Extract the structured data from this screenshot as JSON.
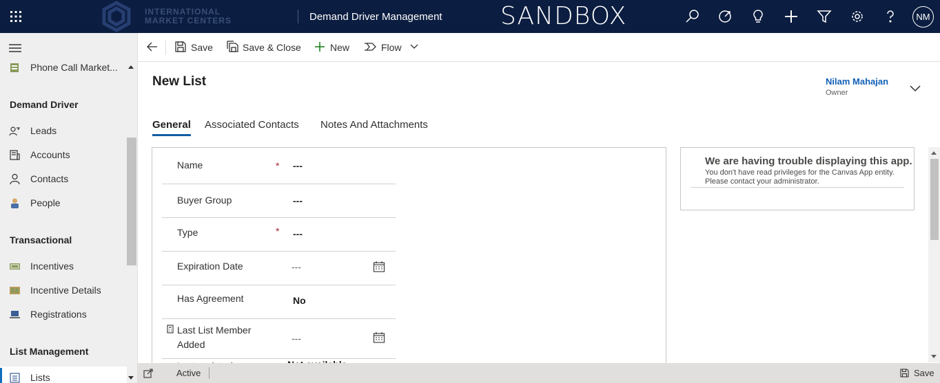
{
  "topbar": {
    "logo_line1": "INTERNATIONAL",
    "logo_line2": "MARKET CENTERS",
    "app_title": "Demand Driver Management",
    "environment": "SANDBOX",
    "avatar_initials": "NM",
    "icons": [
      "search-icon",
      "goals-icon",
      "lightbulb-icon",
      "plus-icon",
      "filter-icon",
      "gear-icon",
      "help-icon"
    ]
  },
  "sidebar": {
    "recent_item": "Phone Call Market...",
    "groups": [
      {
        "title": "Demand Driver",
        "items": [
          "Leads",
          "Accounts",
          "Contacts",
          "People"
        ]
      },
      {
        "title": "Transactional",
        "items": [
          "Incentives",
          "Incentive Details",
          "Registrations"
        ]
      },
      {
        "title": "List Management",
        "items": [
          "Lists"
        ]
      }
    ],
    "selected": "Lists"
  },
  "commandbar": {
    "save": "Save",
    "save_close": "Save & Close",
    "new": "New",
    "flow": "Flow"
  },
  "header": {
    "title": "New List",
    "owner_name": "Nilam Mahajan",
    "owner_label": "Owner"
  },
  "tabs": [
    "General",
    "Associated Contacts",
    "Notes And Attachments"
  ],
  "active_tab": "General",
  "form": {
    "fields": [
      {
        "label": "Name",
        "required": "*",
        "value": "---"
      },
      {
        "label": "Buyer Group",
        "value": "---"
      },
      {
        "label": "Type",
        "required": "*",
        "value": "---"
      },
      {
        "label": "Expiration Date",
        "value": "---"
      },
      {
        "label": "Has Agreement",
        "value": "No"
      },
      {
        "label_line1": "Last List Member",
        "label_line2": "Added",
        "value": "---"
      },
      {
        "label": "Last updated",
        "value": "Not available"
      }
    ]
  },
  "canvas_panel": {
    "heading": "We are having trouble displaying this app.",
    "message_line1": "You don't have read privileges for the Canvas App entity.",
    "message_line2": "Please contact your administrator."
  },
  "statusbar": {
    "status": "Active",
    "save": "Save"
  },
  "colors": {
    "topbar_bg": "#0b1d40",
    "accent": "#115ea3",
    "owner_link": "#1160b7",
    "required": "#a4262c"
  }
}
